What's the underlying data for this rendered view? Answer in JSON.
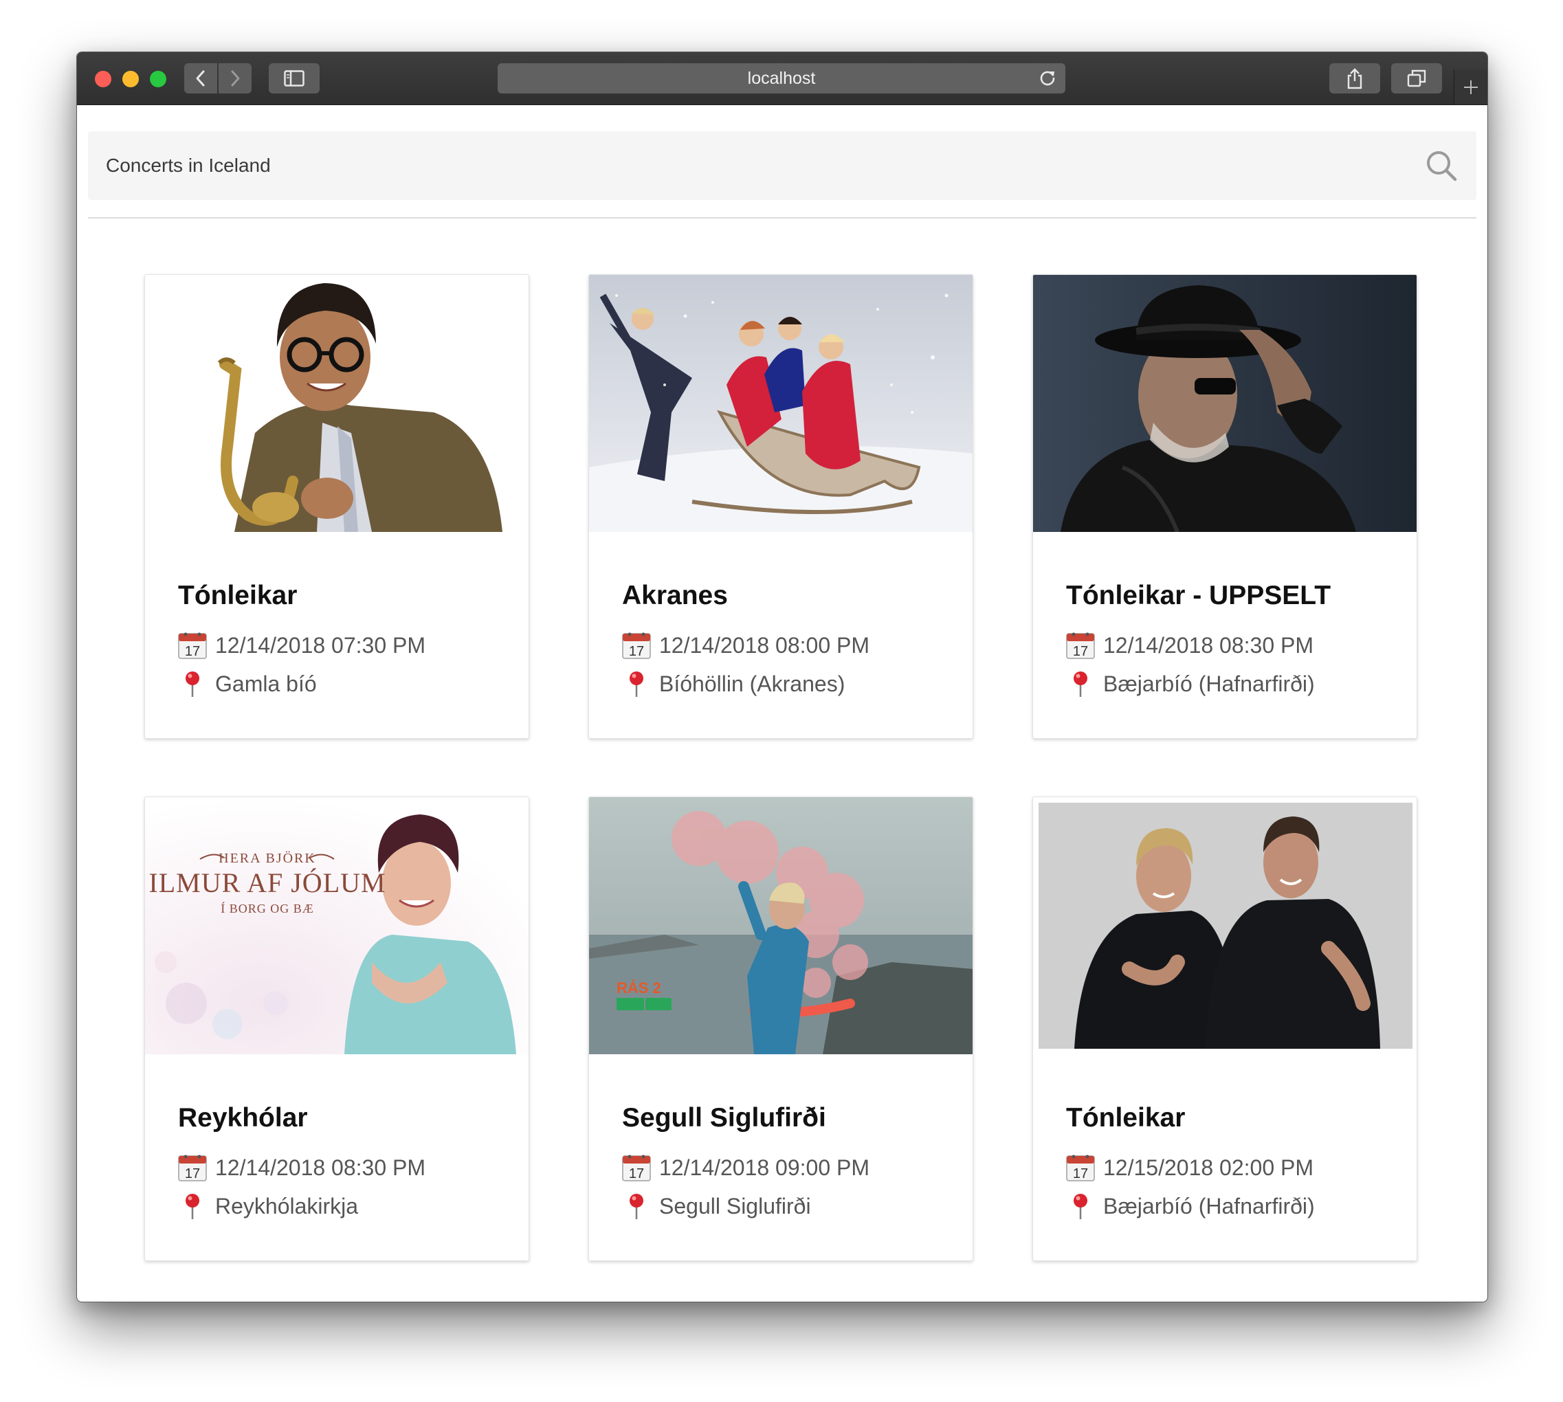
{
  "browser": {
    "url": "localhost"
  },
  "search": {
    "placeholder": "Concerts in Iceland"
  },
  "icons": {
    "date": "calendar-icon",
    "location": "pushpin-icon",
    "search": "search-icon"
  },
  "concerts": [
    {
      "title": "Tónleikar",
      "date": "12/14/2018 07:30 PM",
      "location": "Gamla bíó",
      "calendar_day": "17"
    },
    {
      "title": "Akranes",
      "date": "12/14/2018 08:00 PM",
      "location": "Bíóhöllin (Akranes)",
      "calendar_day": "17"
    },
    {
      "title": "Tónleikar - UPPSELT",
      "date": "12/14/2018 08:30 PM",
      "location": "Bæjarbíó (Hafnarfirði)",
      "calendar_day": "17"
    },
    {
      "title": "Reykhólar",
      "date": "12/14/2018 08:30 PM",
      "location": "Reykhólakirkja",
      "calendar_day": "17",
      "poster_text": {
        "top": "HERA BJÖRK",
        "main": "ILMUR AF JÓLUM",
        "bottom": "Í BORG OG BÆ"
      }
    },
    {
      "title": "Segull Siglufirði",
      "date": "12/14/2018 09:00 PM",
      "location": "Segull Siglufirði",
      "calendar_day": "17",
      "poster_text": {
        "logo": "RÁS 2"
      }
    },
    {
      "title": "Tónleikar",
      "date": "12/15/2018 02:00 PM",
      "location": "Bæjarbíó (Hafnarfirði)",
      "calendar_day": "17"
    }
  ]
}
